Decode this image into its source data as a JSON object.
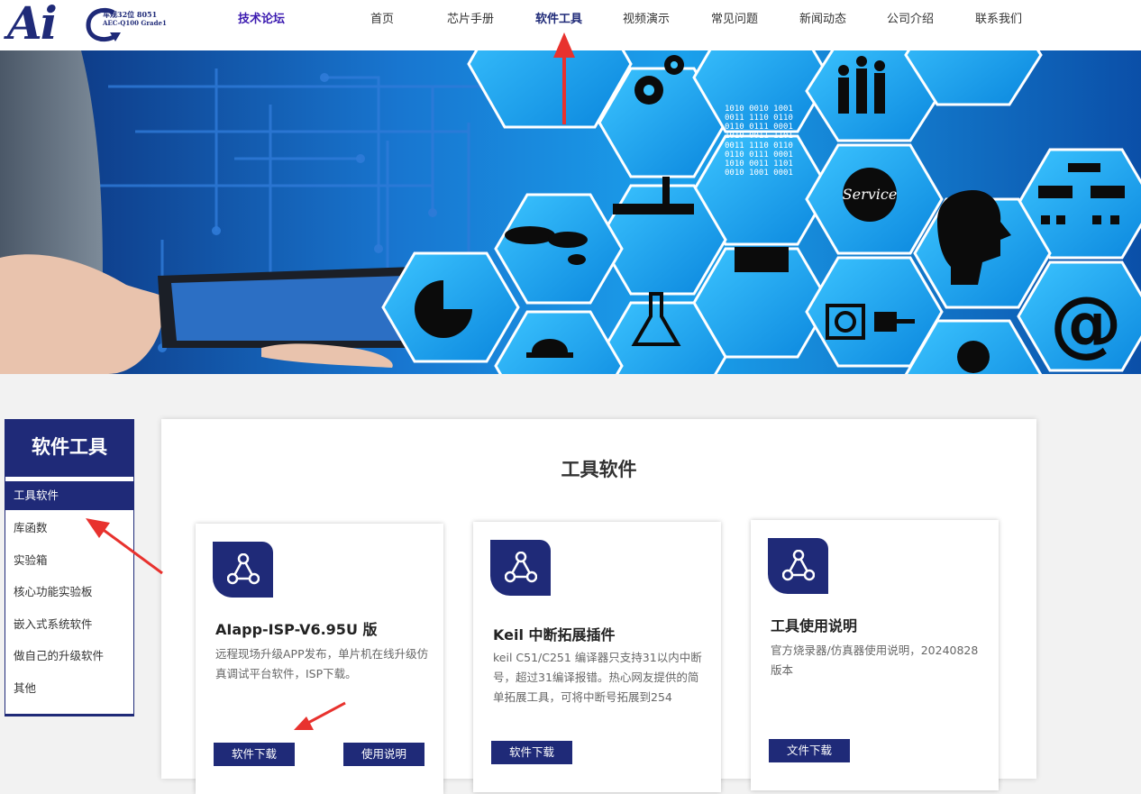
{
  "logo": {
    "mark": "Ai",
    "tagline_1": "车规32位 8051",
    "tagline_2": "AEC-Q100 Grade1"
  },
  "nav": {
    "forum": "技术论坛",
    "items": [
      "首页",
      "芯片手册",
      "软件工具",
      "视频演示",
      "常见问题",
      "新闻动态",
      "公司介绍",
      "联系我们"
    ],
    "active_index": 2
  },
  "banner": {
    "binary_rows": [
      "1010 0010 1001",
      "0011 1110 0110",
      "0110 0111 0001",
      "1010 0011 1101",
      "0011 1110 0110",
      "0110 0111 0001",
      "1010 0011 1101",
      "0010 1001 0001"
    ],
    "service_text": "Service",
    "at_symbol": "@",
    "icons": [
      "gears-icon",
      "binary-code-icon",
      "team-icon",
      "factory-icon",
      "service-gear-icon",
      "org-chart-icon",
      "world-map-icon",
      "microchip-icon",
      "brain-gears-icon",
      "pie-chart-icon",
      "flask-icon",
      "power-plug-icon",
      "at-sign-icon",
      "hard-hat-icon"
    ]
  },
  "sidebar": {
    "title": "软件工具",
    "items": [
      "工具软件",
      "库函数",
      "实验箱",
      "核心功能实验板",
      "嵌入式系统软件",
      "做自己的升级软件",
      "其他"
    ],
    "active_index": 0
  },
  "main": {
    "title": "工具软件",
    "cards": [
      {
        "title": "AIapp-ISP-V6.95U 版",
        "description": "远程现场升级APP发布，单片机在线升级仿真调试平台软件，ISP下载。",
        "buttons": [
          "软件下载",
          "使用说明"
        ]
      },
      {
        "title": "Keil 中断拓展插件",
        "description": "keil C51/C251 编译器只支持31以内中断号，超过31编译报错。热心网友提供的简单拓展工具，可将中断号拓展到254",
        "buttons": [
          "软件下载"
        ]
      },
      {
        "title": "工具使用说明",
        "description": "官方烧录器/仿真器使用说明，20240828版本",
        "buttons": [
          "文件下载"
        ]
      }
    ]
  },
  "colors": {
    "brand_navy": "#1f2a78",
    "forum_purple": "#3b1ab0",
    "annotation_red": "#e8322e",
    "banner_blue": "#1aa0ec"
  }
}
